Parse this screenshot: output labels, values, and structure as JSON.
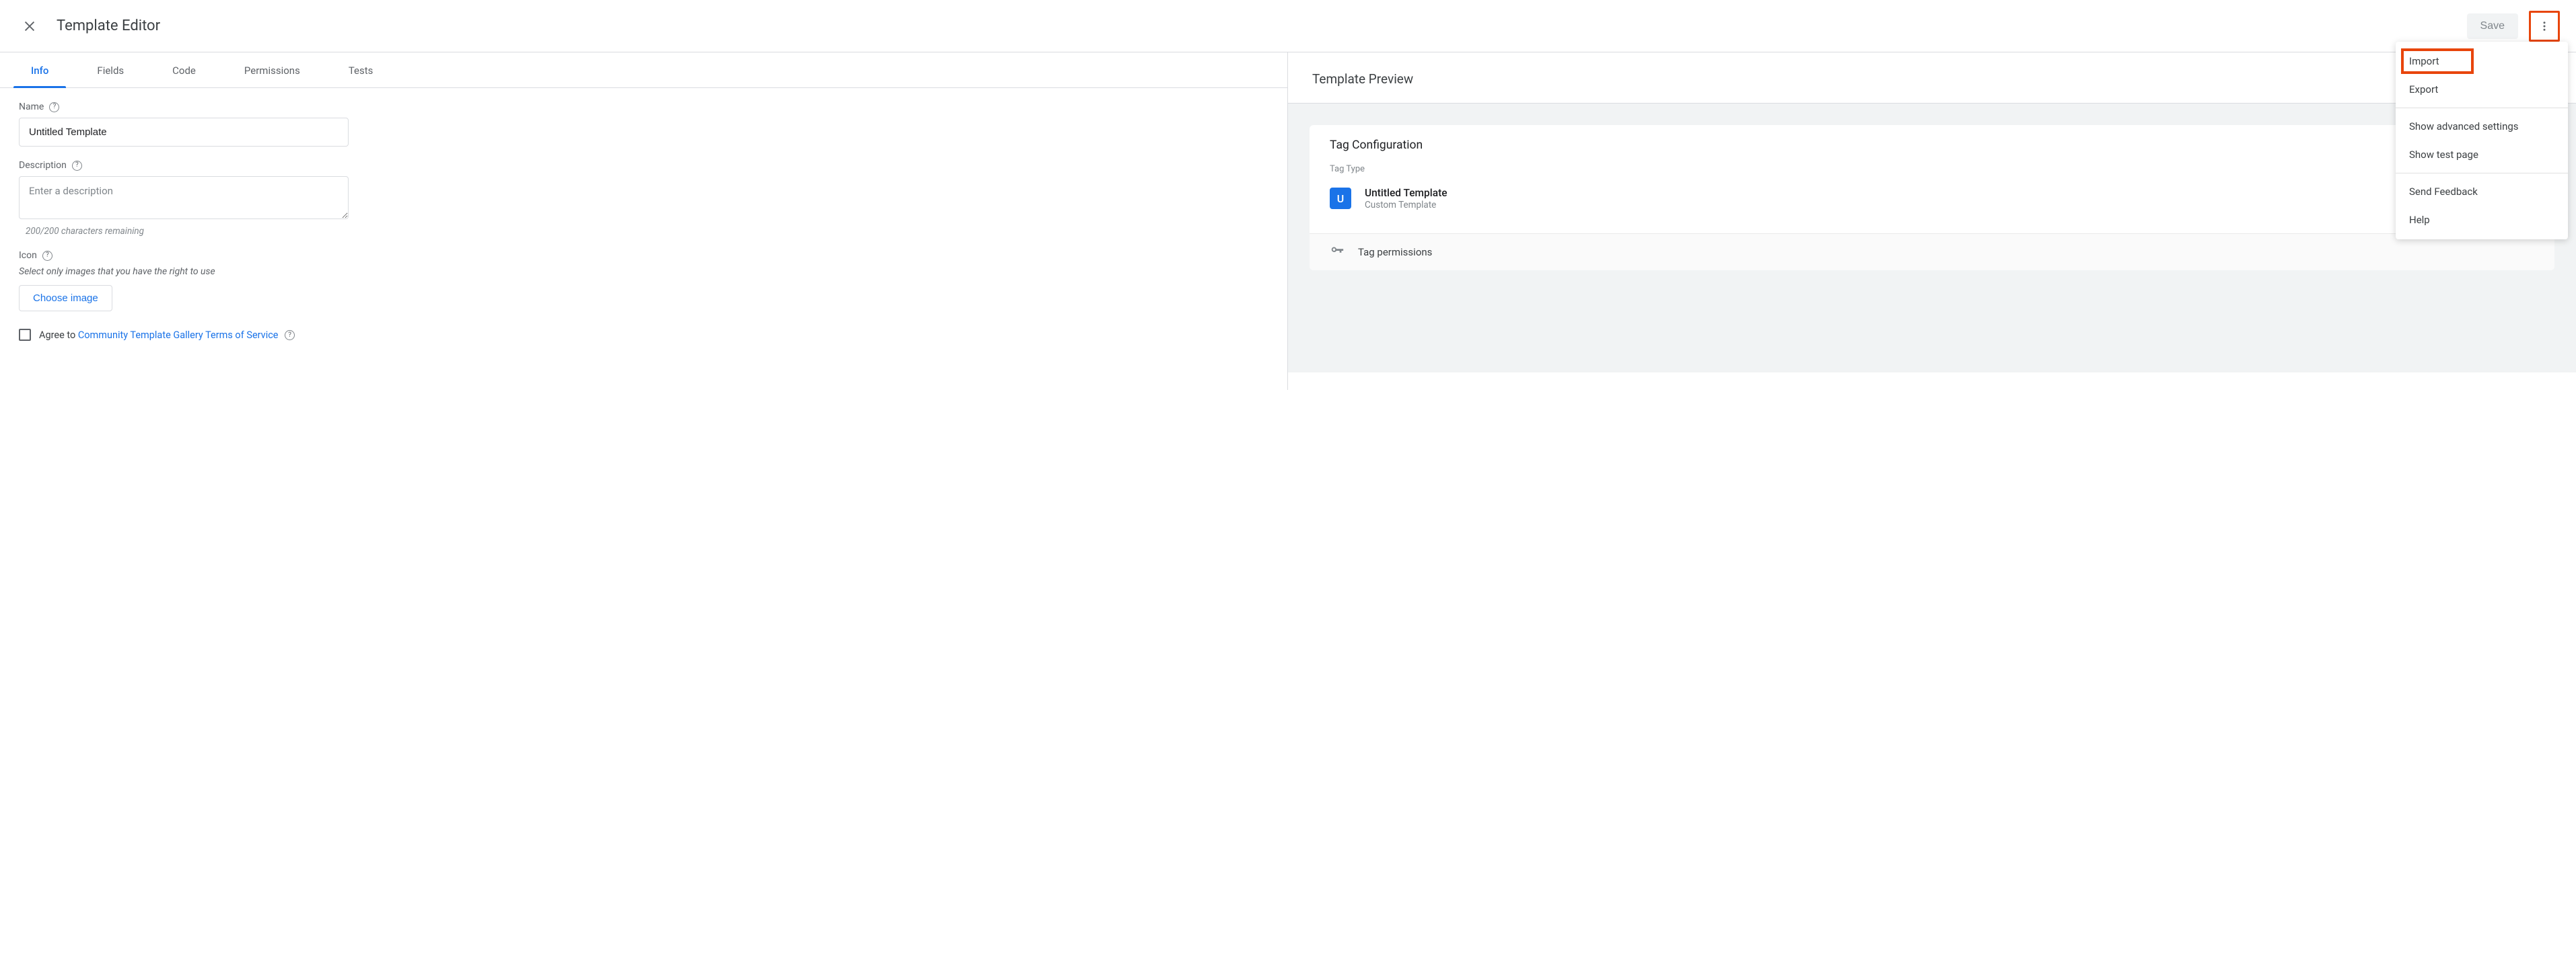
{
  "appbar": {
    "title": "Template Editor",
    "save_label": "Save"
  },
  "tabs": [
    "Info",
    "Fields",
    "Code",
    "Permissions",
    "Tests"
  ],
  "active_tab_index": 0,
  "form": {
    "name_label": "Name",
    "name_value": "Untitled Template",
    "description_label": "Description",
    "description_placeholder": "Enter a description",
    "description_helper": "200/200 characters remaining",
    "icon_label": "Icon",
    "icon_note": "Select only images that you have the right to use",
    "choose_image_label": "Choose image",
    "agree_prefix": "Agree to ",
    "agree_link": "Community Template Gallery Terms of Service"
  },
  "preview": {
    "header": "Template Preview",
    "card_title": "Tag Configuration",
    "tag_type_label": "Tag Type",
    "tag_letter": "U",
    "tag_name": "Untitled Template",
    "tag_subtitle": "Custom Template",
    "permissions_label": "Tag permissions"
  },
  "menu": {
    "items": [
      {
        "label": "Import",
        "highlighted": true
      },
      {
        "label": "Export"
      }
    ],
    "group2": [
      {
        "label": "Show advanced settings"
      },
      {
        "label": "Show test page"
      }
    ],
    "group3": [
      {
        "label": "Send Feedback"
      },
      {
        "label": "Help"
      }
    ]
  }
}
